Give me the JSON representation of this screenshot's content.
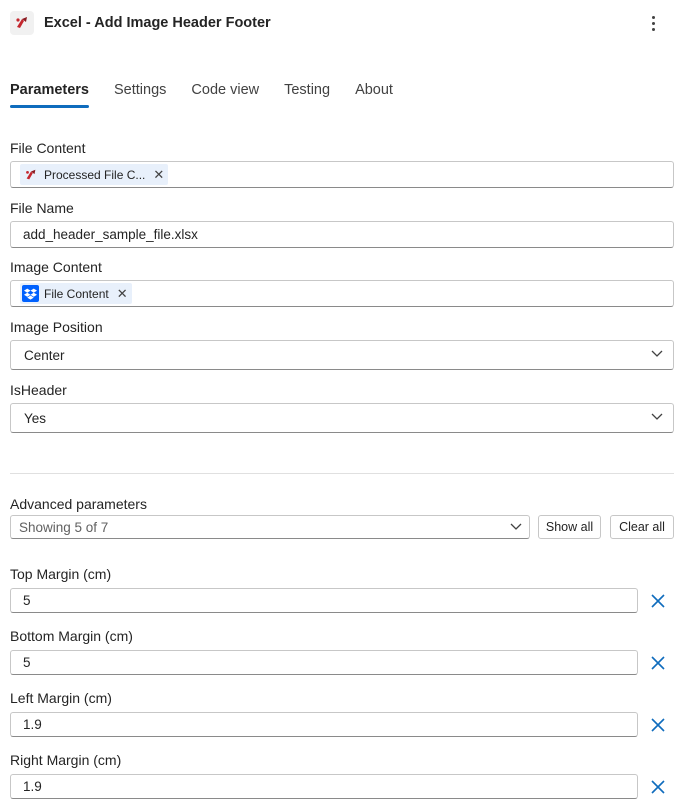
{
  "header": {
    "title": "Excel - Add Image Header Footer",
    "app_icon": "excel-connector-icon",
    "more_icon": "more-vertical-icon"
  },
  "tabs": [
    {
      "label": "Parameters",
      "active": true
    },
    {
      "label": "Settings",
      "active": false
    },
    {
      "label": "Code view",
      "active": false
    },
    {
      "label": "Testing",
      "active": false
    },
    {
      "label": "About",
      "active": false
    }
  ],
  "params": {
    "file_content": {
      "label": "File Content",
      "token": "Processed File C...",
      "token_icon": "excel-connector-icon"
    },
    "file_name": {
      "label": "File Name",
      "value": "add_header_sample_file.xlsx"
    },
    "image_content": {
      "label": "Image Content",
      "token": "File Content",
      "token_icon": "dropbox-icon"
    },
    "image_position": {
      "label": "Image Position",
      "value": "Center"
    },
    "is_header": {
      "label": "IsHeader",
      "value": "Yes"
    }
  },
  "advanced": {
    "label": "Advanced parameters",
    "summary": "Showing 5 of 7",
    "show_all": "Show all",
    "clear_all": "Clear all"
  },
  "margins": [
    {
      "label": "Top Margin (cm)",
      "value": "5"
    },
    {
      "label": "Bottom Margin (cm)",
      "value": "5"
    },
    {
      "label": "Left Margin (cm)",
      "value": "1.9"
    },
    {
      "label": "Right Margin (cm)",
      "value": "1.9"
    }
  ],
  "colors": {
    "accent": "#0f6cbd",
    "token_bg": "#e8f0fb",
    "brand_red": "#c4262e"
  }
}
